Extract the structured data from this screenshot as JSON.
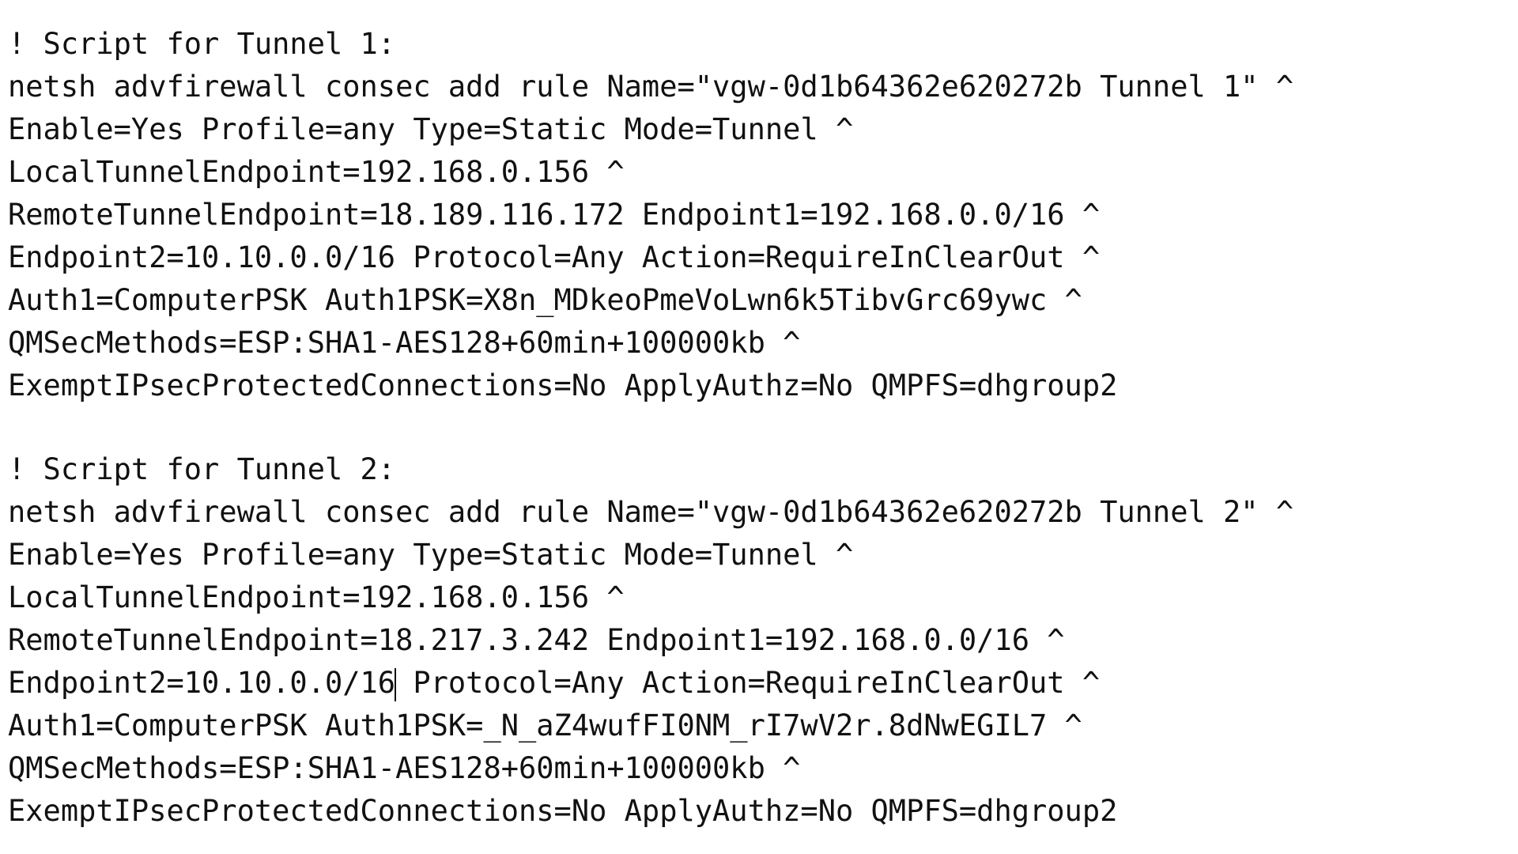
{
  "tunnel1": {
    "lines": [
      "! Script for Tunnel 1:",
      "netsh advfirewall consec add rule Name=\"vgw-0d1b64362e620272b Tunnel 1\" ^",
      "Enable=Yes Profile=any Type=Static Mode=Tunnel ^",
      "LocalTunnelEndpoint=192.168.0.156 ^",
      "RemoteTunnelEndpoint=18.189.116.172 Endpoint1=192.168.0.0/16 ^",
      "Endpoint2=10.10.0.0/16 Protocol=Any Action=RequireInClearOut ^",
      "Auth1=ComputerPSK Auth1PSK=X8n_MDkeoPmeVoLwn6k5TibvGrc69ywc ^",
      "QMSecMethods=ESP:SHA1-AES128+60min+100000kb ^",
      "ExemptIPsecProtectedConnections=No ApplyAuthz=No QMPFS=dhgroup2"
    ]
  },
  "tunnel2": {
    "lines": [
      "! Script for Tunnel 2:",
      "netsh advfirewall consec add rule Name=\"vgw-0d1b64362e620272b Tunnel 2\" ^",
      "Enable=Yes Profile=any Type=Static Mode=Tunnel ^",
      "LocalTunnelEndpoint=192.168.0.156 ^",
      "RemoteTunnelEndpoint=18.217.3.242 Endpoint1=192.168.0.0/16 ^",
      "Endpoint2=10.10.0.0/16",
      " Protocol=Any Action=RequireInClearOut ^",
      "Auth1=ComputerPSK Auth1PSK=_N_aZ4wufFI0NM_rI7wV2r.8dNwEGIL7 ^",
      "QMSecMethods=ESP:SHA1-AES128+60min+100000kb ^",
      "ExemptIPsecProtectedConnections=No ApplyAuthz=No QMPFS=dhgroup2"
    ]
  },
  "colors": {
    "text": "#111111",
    "background": "#ffffff"
  }
}
